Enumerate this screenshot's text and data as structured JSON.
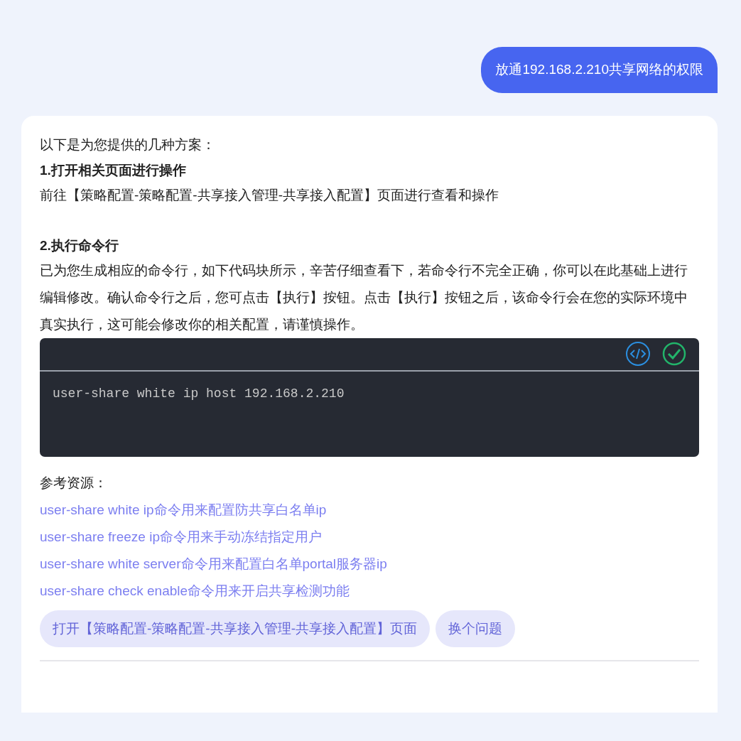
{
  "user_message": "放通192.168.2.210共享网络的权限",
  "reply": {
    "intro": "以下是为您提供的几种方案：",
    "sections": [
      {
        "heading": "1.打开相关页面进行操作",
        "paragraphs": [
          "前往【策略配置-策略配置-共享接入管理-共享接入配置】页面进行查看和操作"
        ]
      },
      {
        "heading": "2.执行命令行",
        "paragraphs": [
          "已为您生成相应的命令行，如下代码块所示，辛苦仔细查看下，若命令行不完全正确，你可以在此基础上进行编辑修改。确认命令行之后，您可点击【执行】按钮。点击【执行】按钮之后，该命令行会在您的实际环境中真实执行，这可能会修改你的相关配置，请谨慎操作。"
        ]
      }
    ],
    "code": "user-share white ip host 192.168.2.210",
    "references_label": "参考资源：",
    "references": [
      "user-share white ip命令用来配置防共享白名单ip",
      "user-share freeze ip命令用来手动冻结指定用户",
      "user-share white server命令用来配置白名单portal服务器ip",
      "user-share check enable命令用来开启共享检测功能"
    ],
    "suggestions": [
      "打开【策略配置-策略配置-共享接入管理-共享接入配置】页面",
      "换个问题"
    ]
  }
}
